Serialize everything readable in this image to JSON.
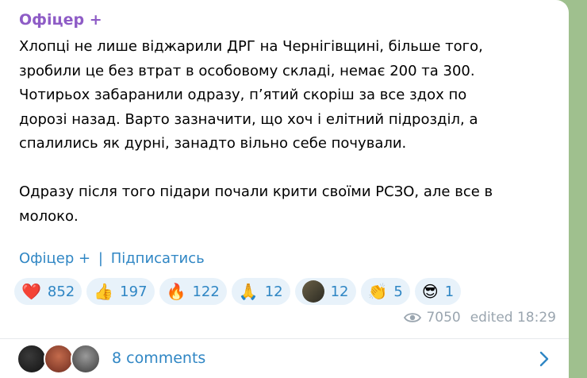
{
  "post": {
    "author": "Офіцер",
    "author_badge": "+",
    "text": "Хлопці не лише віджарили ДРГ на Чернігівщині, більше того,\nзробили це без втрат в особовому складі, немає 200 та 300.\nЧотирьох забаранили одразу, п’ятий скоріш за все здох по\nдорозі назад. Варто зазначити, що хоч і елітний підрозділ, а\nспалились як дурні, занадто вільно себе почували.\n\nОдразу після того підари почали крити своїми РСЗО, але все в\nмолоко.",
    "signature": {
      "channel": "Офіцер",
      "badge": "+",
      "separator": "|",
      "subscribe": "Підписатись"
    },
    "reactions": [
      {
        "emoji": "❤️",
        "icon": "heart-icon",
        "count": "852"
      },
      {
        "emoji": "👍",
        "icon": "thumbs-up-icon",
        "count": "197"
      },
      {
        "emoji": "🔥",
        "icon": "fire-icon",
        "count": "122"
      },
      {
        "emoji": "🙏",
        "icon": "pray-icon",
        "count": "12"
      },
      {
        "emoji": "",
        "icon": "avatar-reaction-icon",
        "count": "12"
      },
      {
        "emoji": "👏",
        "icon": "clap-icon",
        "count": "5"
      },
      {
        "emoji": "😎",
        "icon": "sunglasses-face-icon",
        "count": "1"
      }
    ],
    "views": "7050",
    "edited": "edited 18:29",
    "comments": "8 comments"
  },
  "colors": {
    "author": "#8e5cc6",
    "link": "#2f86c4",
    "reaction_bg": "#e8f2fa",
    "background": "#9fc08e"
  }
}
